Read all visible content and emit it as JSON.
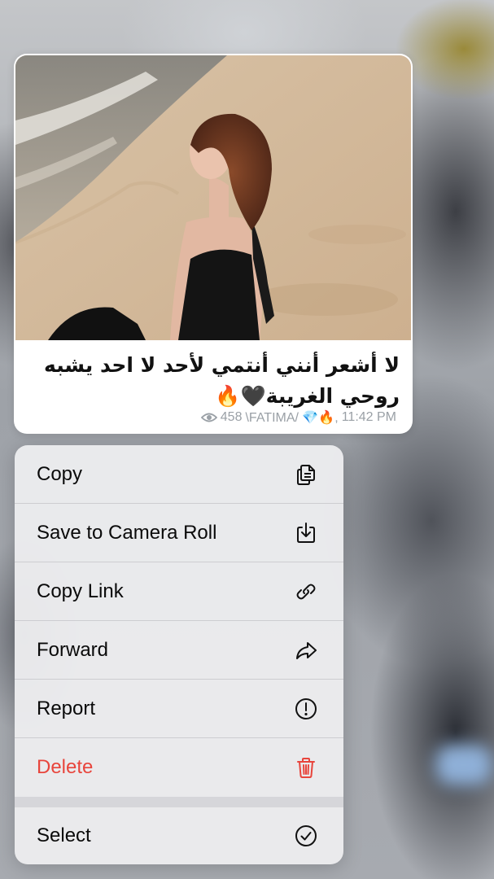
{
  "message": {
    "text": "لا أشعر أنني أنتمي لأحد لا احد يشبه روحي الغريبة🖤🔥",
    "views": "458",
    "signature": "\\FATIMA/ 💎🔥,",
    "time": "11:42 PM",
    "photo_subject": "woman-on-beach"
  },
  "menu": {
    "items": [
      {
        "label": "Copy",
        "icon": "copy-icon"
      },
      {
        "label": "Save to Camera Roll",
        "icon": "save-download-icon"
      },
      {
        "label": "Copy Link",
        "icon": "link-icon"
      },
      {
        "label": "Forward",
        "icon": "forward-arrow-icon"
      },
      {
        "label": "Report",
        "icon": "exclamation-circle-icon"
      },
      {
        "label": "Delete",
        "icon": "trash-icon"
      },
      {
        "label": "Select",
        "icon": "checkmark-circle-icon"
      }
    ]
  },
  "colors": {
    "destructive": "#e8453c",
    "menu_background": "#ececee",
    "meta_text": "#9aa0a6"
  }
}
